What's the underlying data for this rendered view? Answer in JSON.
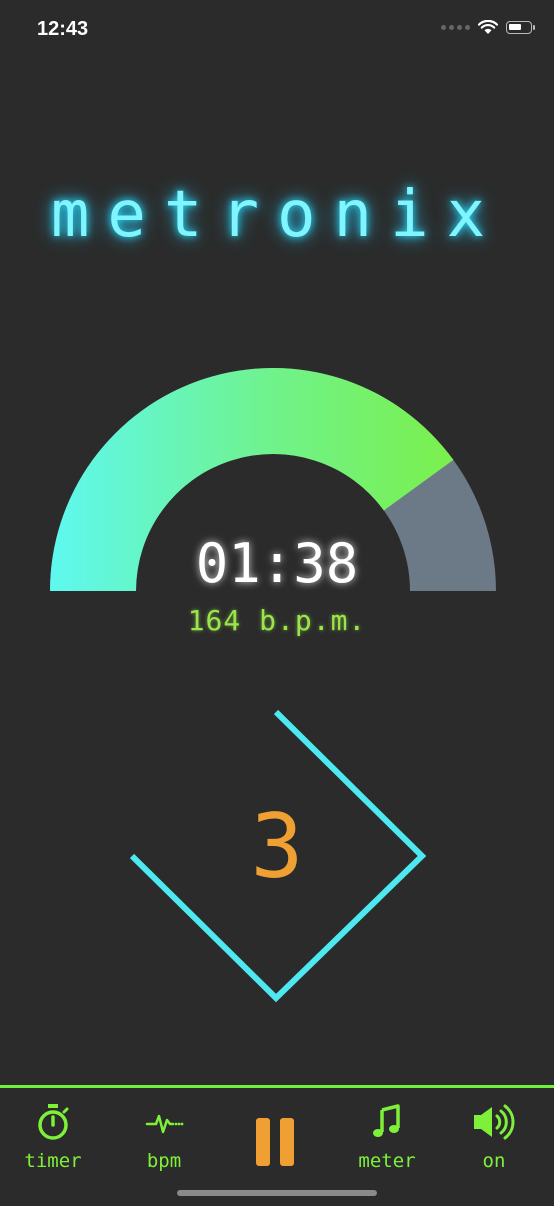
{
  "status_bar": {
    "time": "12:43",
    "icons": [
      "signal-dots-icon",
      "wifi-icon",
      "battery-icon"
    ]
  },
  "app": {
    "title": "metronix"
  },
  "timer": {
    "elapsed": "01:38",
    "bpm_text": "164 b.p.m.",
    "progress_fraction": 0.8
  },
  "beat": {
    "current": "3"
  },
  "colors": {
    "background": "#2b2b2b",
    "title": "#7ff5ff",
    "gauge_start": "#5ef8f0",
    "gauge_end": "#7bf04a",
    "gauge_remaining": "#6c7986",
    "bpm": "#9ae64a",
    "beat_shape": "#4ee8f0",
    "beat_number": "#f0a032",
    "tab_accent": "#7ef03a",
    "pause": "#f0a032"
  },
  "tabbar": {
    "items": [
      {
        "label": "timer",
        "icon": "stopwatch-icon"
      },
      {
        "label": "bpm",
        "icon": "heartbeat-icon"
      },
      {
        "label": "",
        "icon": "pause-icon"
      },
      {
        "label": "meter",
        "icon": "music-note-icon"
      },
      {
        "label": "on",
        "icon": "speaker-icon"
      }
    ]
  }
}
